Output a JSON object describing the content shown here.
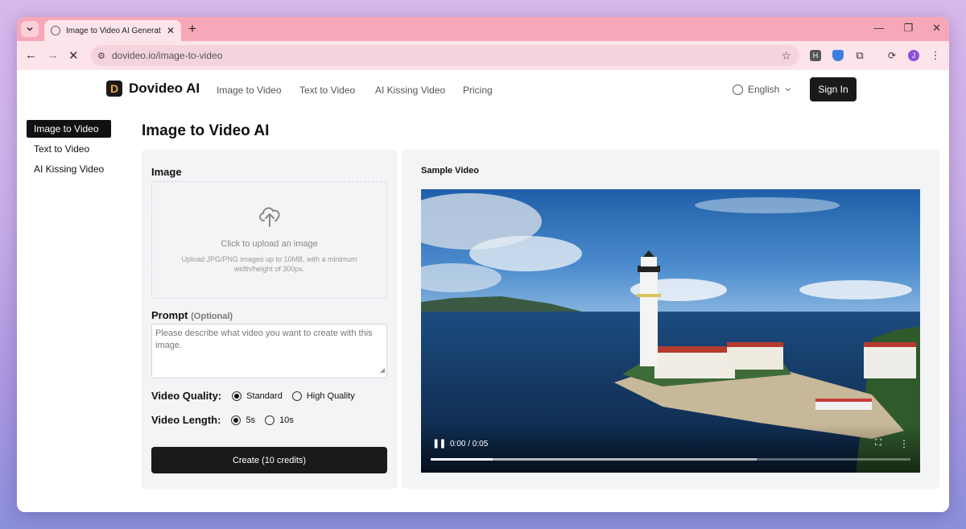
{
  "browser": {
    "tab_title": "Image to Video AI Generator: T",
    "new_tab": "+",
    "url": "dovideo.io/image-to-video",
    "profile_initial": "J",
    "ext_h": "H"
  },
  "header": {
    "logo_mark": "D",
    "logo_text": "Dovideo AI",
    "nav": [
      "Image to Video",
      "Text to Video",
      "AI Kissing Video",
      "Pricing"
    ],
    "language": "English",
    "signin": "Sign In"
  },
  "sidebar": {
    "items": [
      {
        "label": "Image to Video",
        "active": true
      },
      {
        "label": "Text to Video",
        "active": false
      },
      {
        "label": "AI Kissing Video",
        "active": false
      }
    ]
  },
  "main": {
    "title": "Image to Video AI",
    "image_label": "Image",
    "upload_title": "Click to upload an image",
    "upload_hint": "Upload JPG/PNG images up to 10MB, with a minimum width/height of 300px.",
    "prompt_label": "Prompt",
    "prompt_optional": "(Optional)",
    "prompt_placeholder": "Please describe what video you want to create with this image.",
    "quality_label": "Video Quality:",
    "quality_options": [
      "Standard",
      "High Quality"
    ],
    "quality_selected": "Standard",
    "length_label": "Video Length:",
    "length_options": [
      "5s",
      "10s"
    ],
    "length_selected": "5s",
    "create_button": "Create (10 credits)"
  },
  "sample": {
    "label": "Sample Video",
    "time": "0:00 / 0:05",
    "progress_played": 0.13,
    "progress_buffered": 0.68
  },
  "colors": {
    "tabstrip": "#f7a8b8",
    "toolbar": "#fce4ea",
    "accent_dark": "#1a1a1a",
    "panel_bg": "#f3f4f6"
  }
}
